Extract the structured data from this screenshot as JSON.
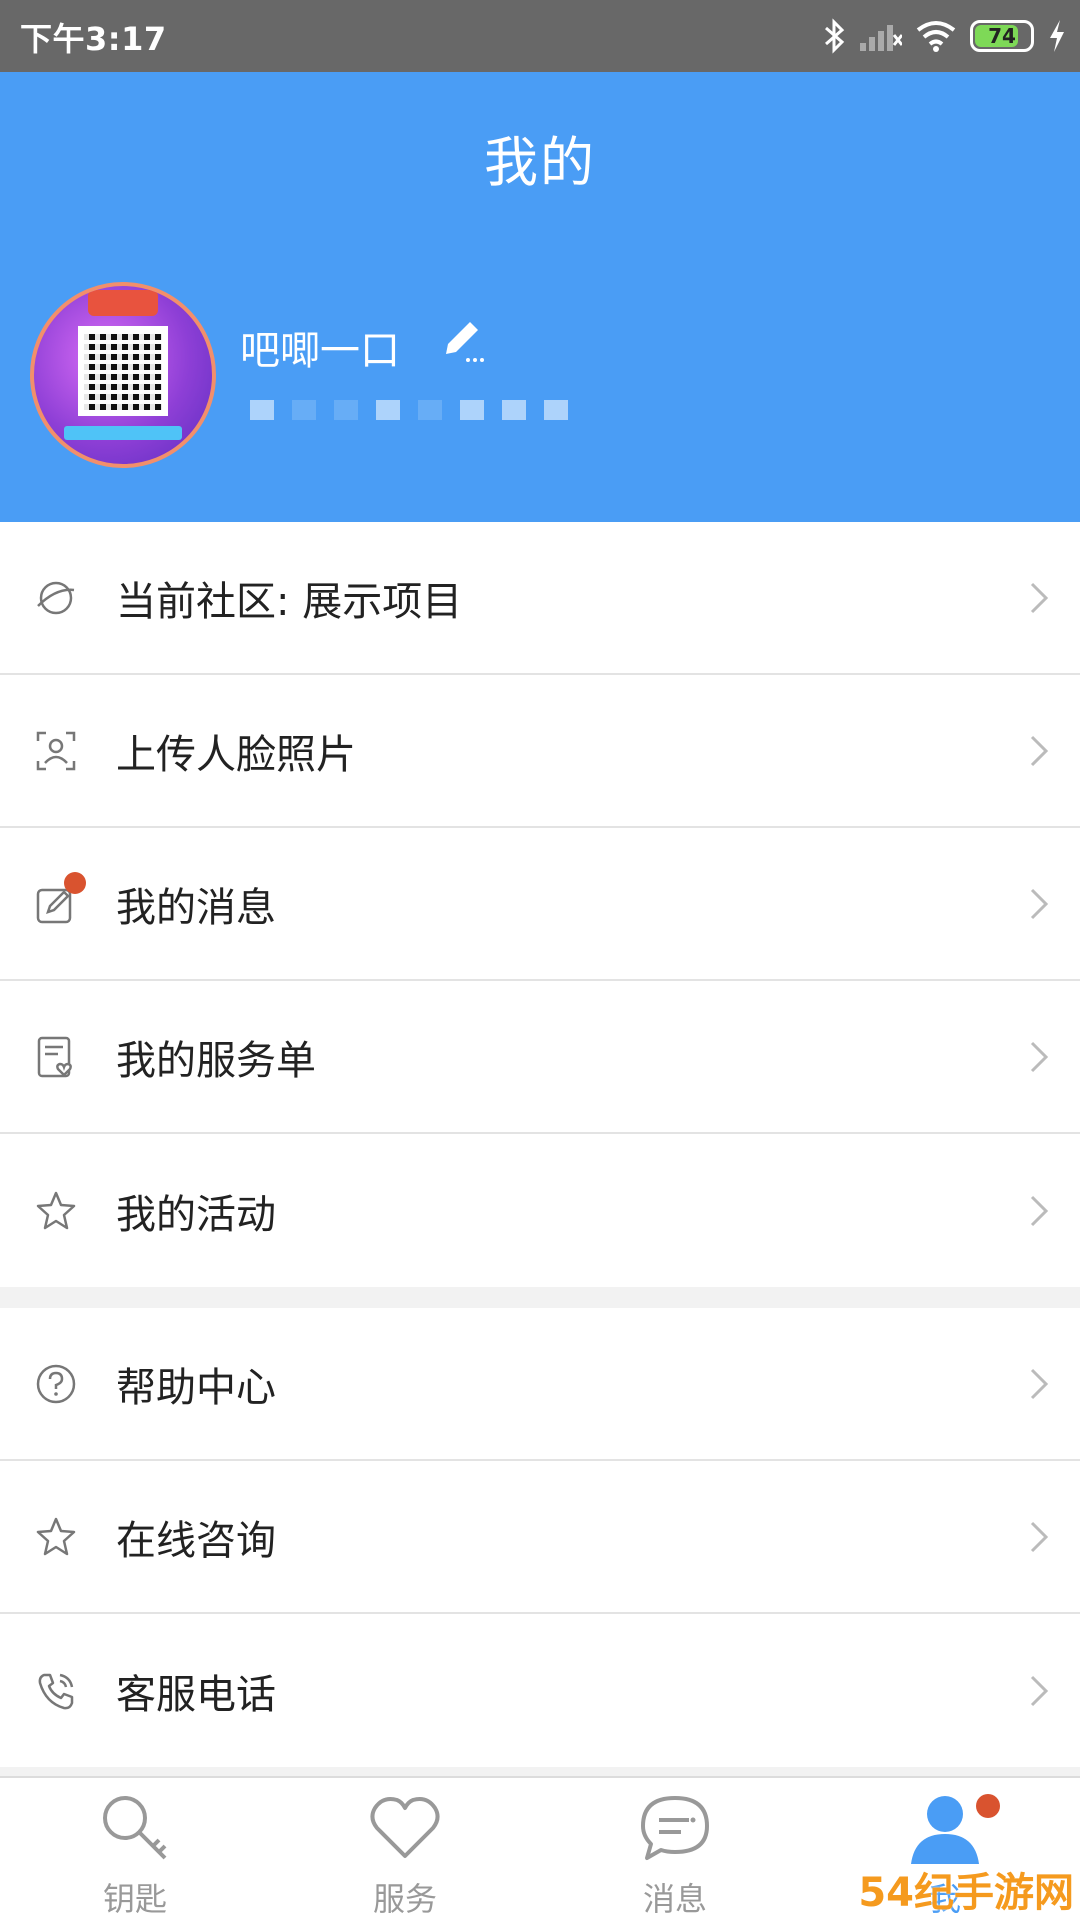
{
  "status_bar": {
    "time": "下午3:17",
    "battery": "74",
    "icons": [
      "bluetooth-icon",
      "signal-icon",
      "wifi-icon",
      "battery-icon",
      "charging-icon"
    ]
  },
  "header": {
    "title": "我的",
    "username": "吧唧一口",
    "bg_color": "#4a9df5"
  },
  "menu_group_1": [
    {
      "label": "当前社区: 展示项目",
      "icon": "planet-icon"
    },
    {
      "label": "上传人脸照片",
      "icon": "face-scan-icon"
    },
    {
      "label": "我的消息",
      "icon": "message-edit-icon",
      "badge": true
    },
    {
      "label": "我的服务单",
      "icon": "service-order-icon"
    },
    {
      "label": "我的活动",
      "icon": "star-icon"
    }
  ],
  "menu_group_2": [
    {
      "label": "帮助中心",
      "icon": "help-icon"
    },
    {
      "label": "在线咨询",
      "icon": "star-icon"
    },
    {
      "label": "客服电话",
      "icon": "phone-icon"
    }
  ],
  "bottom_nav": [
    {
      "label": "钥匙",
      "icon": "key-icon"
    },
    {
      "label": "服务",
      "icon": "heart-icon"
    },
    {
      "label": "消息",
      "icon": "chat-icon"
    },
    {
      "label": "我",
      "icon": "person-icon",
      "active": true
    }
  ],
  "watermark": "54纪手游网"
}
